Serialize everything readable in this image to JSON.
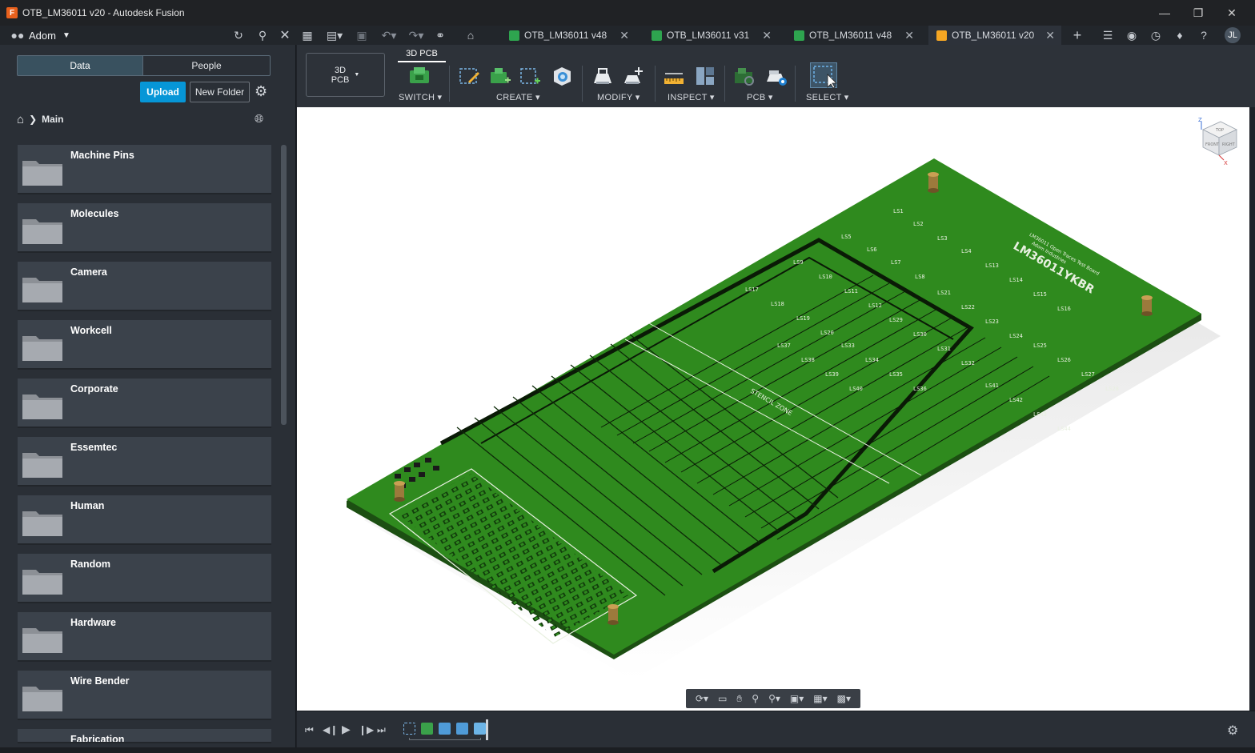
{
  "window": {
    "title": "OTB_LM36011 v20 - Autodesk Fusion",
    "app_icon_letter": "F"
  },
  "appbar": {
    "team_name": "Adom",
    "avatar_initials": "JL",
    "tabs": [
      {
        "label": "OTB_LM36011 v48",
        "active": false,
        "icon_color": "#2ea44f"
      },
      {
        "label": "OTB_LM36011 v31",
        "active": false,
        "icon_color": "#2ea44f"
      },
      {
        "label": "OTB_LM36011 v48",
        "active": false,
        "icon_color": "#2ea44f"
      },
      {
        "label": "OTB_LM36011 v20",
        "active": true,
        "icon_color": "#f5a623"
      }
    ]
  },
  "data_panel": {
    "tab_data": "Data",
    "tab_people": "People",
    "upload_label": "Upload",
    "new_folder_label": "New Folder",
    "breadcrumb": "Main",
    "folders": [
      "Machine Pins",
      "Molecules",
      "Camera",
      "Workcell",
      "Corporate",
      "Essemtec",
      "Human",
      "Random",
      "Hardware",
      "Wire Bender",
      "Fabrication"
    ]
  },
  "toolbar": {
    "workspace_line1": "3D",
    "workspace_line2": "PCB",
    "active_tab": "3D PCB",
    "groups": [
      "SWITCH",
      "CREATE",
      "MODIFY",
      "INSPECT",
      "PCB",
      "SELECT"
    ]
  },
  "viewcube": {
    "top": "TOP",
    "front": "FRONT",
    "right": "RIGHT",
    "axis_x": "X",
    "axis_z": "Z"
  },
  "board": {
    "title": "LM36011YKBR",
    "subtitle1": "LM36011 Open Traces Test Board",
    "subtitle2": "Adom Industries",
    "label_stencil": "STENCIL ZONE"
  },
  "colors": {
    "accent": "#0696d7",
    "pcb_green": "#2f8a1e",
    "pcb_dark": "#1a5210"
  }
}
